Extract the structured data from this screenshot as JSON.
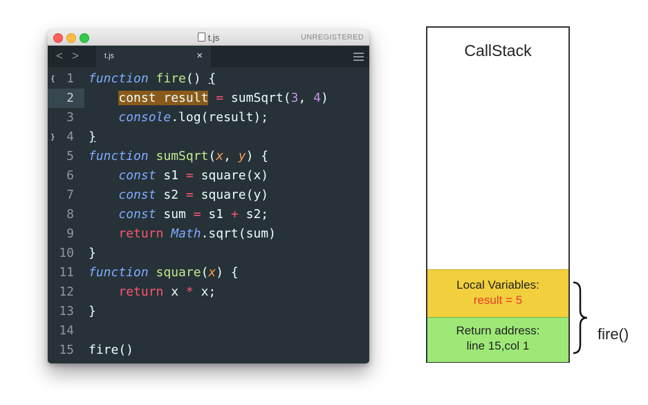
{
  "window": {
    "title": "t.js",
    "badge": "UNREGISTERED",
    "nav_back": "<",
    "nav_forward": ">",
    "tab_label": "t.js",
    "tab_close": "×"
  },
  "code": {
    "current_line": 2,
    "lines": [
      {
        "n": "1",
        "fold": "{",
        "tokens": [
          [
            "kw",
            "function"
          ],
          [
            "",
            ""
          ],
          [
            "fn",
            " fire"
          ],
          [
            "",
            "() "
          ],
          [
            "ul",
            "{"
          ]
        ]
      },
      {
        "n": "2",
        "fold": "",
        "tokens": [
          [
            "",
            "    "
          ],
          [
            "hl",
            "const result"
          ],
          [
            "",
            ""
          ],
          [
            "op",
            " ="
          ],
          [
            "",
            " sumSqrt("
          ],
          [
            "num",
            "3"
          ],
          [
            "",
            ", "
          ],
          [
            "num",
            "4"
          ],
          [
            "",
            ")"
          ]
        ]
      },
      {
        "n": "3",
        "fold": "",
        "tokens": [
          [
            "",
            "    "
          ],
          [
            "kw",
            "console"
          ],
          [
            "",
            ".log(result);"
          ]
        ]
      },
      {
        "n": "4",
        "fold": "}",
        "tokens": [
          [
            "ul",
            "}"
          ]
        ]
      },
      {
        "n": "5",
        "fold": "",
        "tokens": [
          [
            "kw",
            "function"
          ],
          [
            "fn",
            " sumSqrt"
          ],
          [
            "",
            "("
          ],
          [
            "par",
            "x"
          ],
          [
            "",
            ", "
          ],
          [
            "par",
            "y"
          ],
          [
            "",
            ") {"
          ]
        ]
      },
      {
        "n": "6",
        "fold": "",
        "tokens": [
          [
            "",
            "    "
          ],
          [
            "kw",
            "const"
          ],
          [
            "",
            " s1 "
          ],
          [
            "op",
            "="
          ],
          [
            "",
            " square(x)"
          ]
        ]
      },
      {
        "n": "7",
        "fold": "",
        "tokens": [
          [
            "",
            "    "
          ],
          [
            "kw",
            "const"
          ],
          [
            "",
            " s2 "
          ],
          [
            "op",
            "="
          ],
          [
            "",
            " square(y)"
          ]
        ]
      },
      {
        "n": "8",
        "fold": "",
        "tokens": [
          [
            "",
            "    "
          ],
          [
            "kw",
            "const"
          ],
          [
            "",
            " sum "
          ],
          [
            "op",
            "="
          ],
          [
            "",
            " s1 "
          ],
          [
            "op",
            "+"
          ],
          [
            "",
            " s2;"
          ]
        ]
      },
      {
        "n": "9",
        "fold": "",
        "tokens": [
          [
            "",
            "    "
          ],
          [
            "ret",
            "return"
          ],
          [
            "kw",
            " Math"
          ],
          [
            "",
            ".sqrt(sum)"
          ]
        ]
      },
      {
        "n": "10",
        "fold": "",
        "tokens": [
          [
            "",
            "}"
          ]
        ]
      },
      {
        "n": "11",
        "fold": "",
        "tokens": [
          [
            "kw",
            "function"
          ],
          [
            "fn",
            " square"
          ],
          [
            "",
            "("
          ],
          [
            "par",
            "x"
          ],
          [
            "",
            ") {"
          ]
        ]
      },
      {
        "n": "12",
        "fold": "",
        "tokens": [
          [
            "",
            "    "
          ],
          [
            "ret",
            "return"
          ],
          [
            "",
            " x "
          ],
          [
            "op",
            "*"
          ],
          [
            "",
            " x;"
          ]
        ]
      },
      {
        "n": "13",
        "fold": "",
        "tokens": [
          [
            "",
            "}"
          ]
        ]
      },
      {
        "n": "14",
        "fold": "",
        "tokens": []
      },
      {
        "n": "15",
        "fold": "",
        "tokens": [
          [
            "",
            "fire()"
          ]
        ]
      }
    ]
  },
  "callstack": {
    "title": "CallStack",
    "locals_label": "Local Variables:",
    "locals_value": "result = 5",
    "return_label": "Return address:",
    "return_value": "line 15,col 1",
    "frame_name": "fire()"
  },
  "colors": {
    "editor_bg": "#263238",
    "locals_bg": "#f2cf3c",
    "return_bg": "#9ee877",
    "locals_value": "#e8392b",
    "highlight": "#8a5a1a"
  },
  "icons": {
    "traffic_lights": [
      "close-icon",
      "minimize-icon",
      "zoom-icon"
    ],
    "file": "file-icon",
    "menu": "hamburger-menu-icon"
  }
}
